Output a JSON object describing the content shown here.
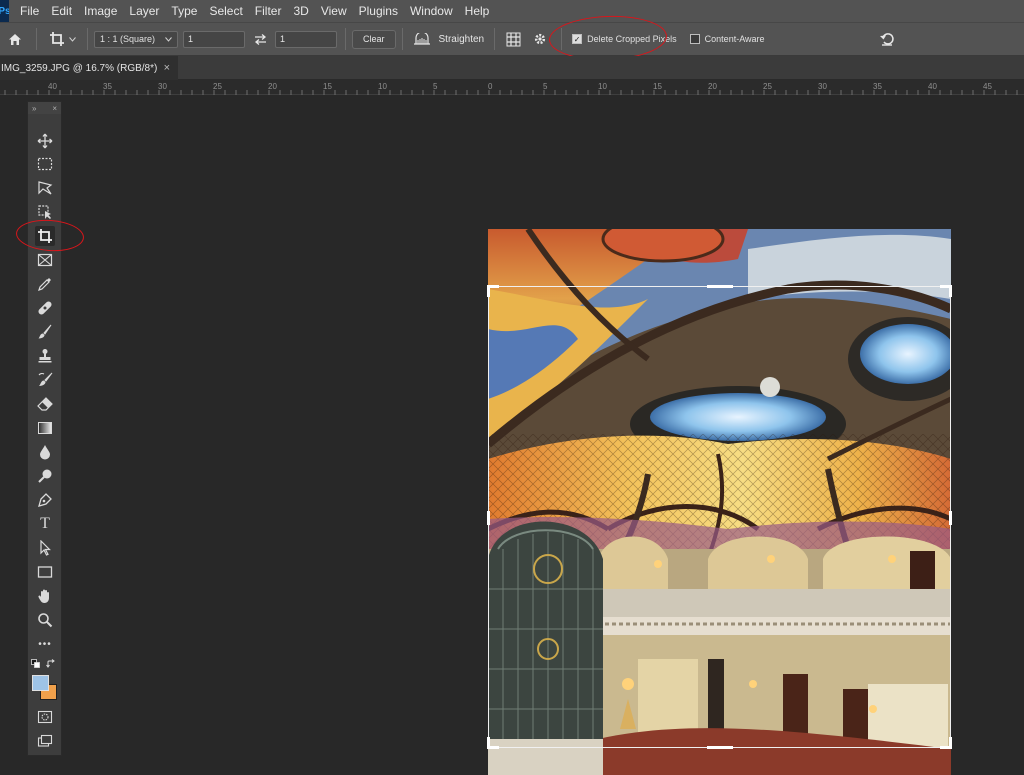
{
  "menu": [
    "File",
    "Edit",
    "Image",
    "Layer",
    "Type",
    "Select",
    "Filter",
    "3D",
    "View",
    "Plugins",
    "Window",
    "Help"
  ],
  "app_logo": "Ps",
  "options": {
    "ratio_value": "1 : 1 (Square)",
    "width_value": "1",
    "height_value": "1",
    "clear_label": "Clear",
    "straighten_label": "Straighten",
    "delete_cropped_label": "Delete Cropped Pixels",
    "delete_cropped_checked": true,
    "content_aware_label": "Content-Aware",
    "content_aware_checked": false
  },
  "tab": {
    "title": "IMG_3259.JPG @ 16.7% (RGB/8*)",
    "close": "×"
  },
  "ruler_labels": [
    "40",
    "35",
    "30",
    "25",
    "20",
    "15",
    "10",
    "5",
    "0",
    "5",
    "10",
    "15",
    "20",
    "25",
    "30",
    "35",
    "40",
    "45"
  ],
  "toolbox": {
    "collapse": "»",
    "close": "×",
    "tools": [
      "move-tool",
      "marquee-tool",
      "lasso-tool",
      "object-selection-tool",
      "crop-tool",
      "frame-tool",
      "eyedropper-tool",
      "healing-tool",
      "brush-tool",
      "stamp-tool",
      "history-brush-tool",
      "eraser-tool",
      "gradient-tool",
      "blur-tool",
      "dodge-tool",
      "pen-tool",
      "type-tool",
      "path-selection-tool",
      "rectangle-tool",
      "hand-tool",
      "zoom-tool",
      "more-tools"
    ],
    "type_glyph": "T",
    "more_glyph": "•••",
    "foreground_color": "#9ec3e6",
    "background_color": "#f0a04b"
  }
}
